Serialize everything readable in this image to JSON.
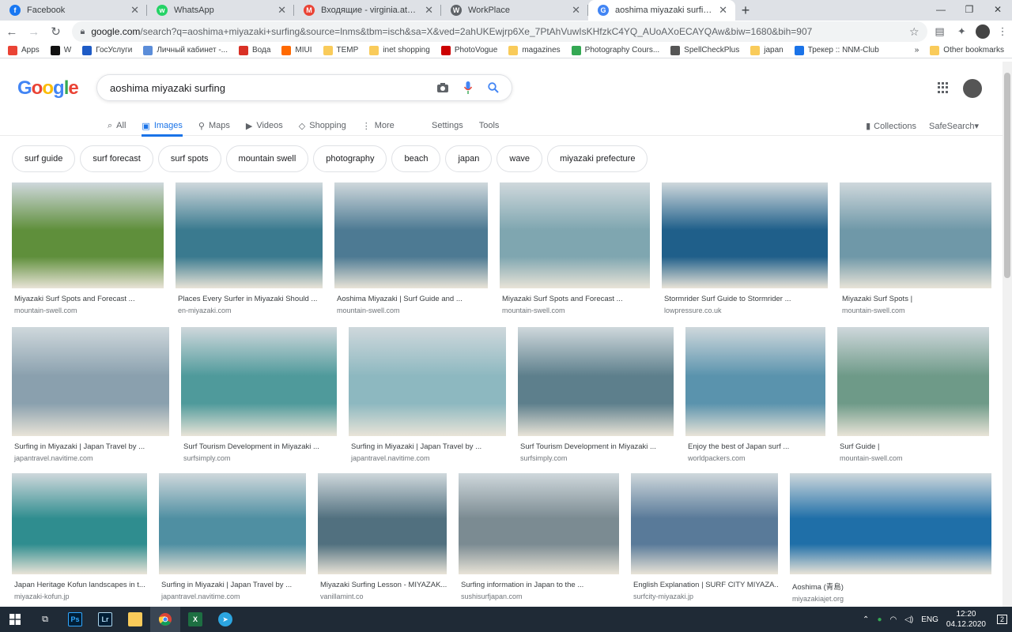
{
  "tabs": [
    {
      "title": "Facebook",
      "color": "#1877f2",
      "glyph": "f"
    },
    {
      "title": "WhatsApp",
      "color": "#25d366",
      "glyph": "w"
    },
    {
      "title": "Входящие - virginia.ateh@gmail.",
      "color": "#ea4335",
      "glyph": "M"
    },
    {
      "title": "WorkPlace",
      "color": "#5f6368",
      "glyph": "W"
    },
    {
      "title": "aoshima miyazaki surfing - Goog",
      "color": "#4285f4",
      "glyph": "G"
    }
  ],
  "address": {
    "host": "google.com",
    "path": "/search?q=aoshima+miyazaki+surfing&source=lnms&tbm=isch&sa=X&ved=2ahUKEwjrp6Xe_7PtAhVuwIsKHfzkC4YQ_AUoAXoECAYQAw&biw=1680&bih=907"
  },
  "bookmarks": [
    {
      "label": "Apps",
      "color": "#ea4335"
    },
    {
      "label": "W",
      "color": "#111111"
    },
    {
      "label": "ГосУслуги",
      "color": "#1e5bc6"
    },
    {
      "label": "Личный кабинет -...",
      "color": "#5b8dd9"
    },
    {
      "label": "Вода",
      "color": "#d93025"
    },
    {
      "label": "MIUI",
      "color": "#ff6900"
    },
    {
      "label": "TEMP",
      "color": "#f9cb5a"
    },
    {
      "label": "inet shopping",
      "color": "#f9cb5a"
    },
    {
      "label": "PhotoVogue",
      "color": "#cc0000"
    },
    {
      "label": "magazines",
      "color": "#f9cb5a"
    },
    {
      "label": "Photography Cours...",
      "color": "#34a853"
    },
    {
      "label": "SpellCheckPlus",
      "color": "#555555"
    },
    {
      "label": "japan",
      "color": "#f9cb5a"
    },
    {
      "label": "Трекер :: NNM-Club",
      "color": "#1a73e8"
    }
  ],
  "bookmarks_other": "Other bookmarks",
  "search": {
    "query": "aoshima miyazaki surfing"
  },
  "gtabs": [
    {
      "label": "All",
      "icon": "search-icon",
      "glyph": "⌕"
    },
    {
      "label": "Images",
      "icon": "image-icon",
      "glyph": "▣"
    },
    {
      "label": "Maps",
      "icon": "map-pin-icon",
      "glyph": "⚲"
    },
    {
      "label": "Videos",
      "icon": "video-icon",
      "glyph": "▶"
    },
    {
      "label": "Shopping",
      "icon": "tag-icon",
      "glyph": "◇"
    },
    {
      "label": "More",
      "icon": "more-icon",
      "glyph": "⋮"
    }
  ],
  "tools": [
    "Settings",
    "Tools"
  ],
  "right": {
    "collections": "Collections",
    "safesearch": "SafeSearch▾"
  },
  "chips": [
    "surf guide",
    "surf forecast",
    "surf spots",
    "mountain swell",
    "photography",
    "beach",
    "japan",
    "wave",
    "miyazaki prefecture"
  ],
  "results": [
    [
      {
        "title": "Miyazaki Surf Spots and Forecast ...",
        "source": "mountain-swell.com"
      },
      {
        "title": "Places Every Surfer in Miyazaki Should ...",
        "source": "en-miyazaki.com"
      },
      {
        "title": "Aoshima Miyazaki | Surf Guide and ...",
        "source": "mountain-swell.com"
      },
      {
        "title": "Miyazaki Surf Spots and Forecast ...",
        "source": "mountain-swell.com"
      },
      {
        "title": "Stormrider Surf Guide to Stormrider ...",
        "source": "lowpressure.co.uk"
      },
      {
        "title": "Miyazaki Surf Spots |",
        "source": "mountain-swell.com"
      }
    ],
    [
      {
        "title": "Surfing in Miyazaki | Japan Travel by ...",
        "source": "japantravel.navitime.com"
      },
      {
        "title": "Surf Tourism Development in Miyazaki ...",
        "source": "surfsimply.com"
      },
      {
        "title": "Surfing in Miyazaki | Japan Travel by ...",
        "source": "japantravel.navitime.com"
      },
      {
        "title": "Surf Tourism Development in Miyazaki ...",
        "source": "surfsimply.com"
      },
      {
        "title": "Enjoy the best of Japan surf ...",
        "source": "worldpackers.com"
      },
      {
        "title": "Surf Guide |",
        "source": "mountain-swell.com"
      }
    ],
    [
      {
        "title": "Japan Heritage Kofun landscapes in t...",
        "source": "miyazaki-kofun.jp"
      },
      {
        "title": "Surfing in Miyazaki | Japan Travel by ...",
        "source": "japantravel.navitime.com"
      },
      {
        "title": "Miyazaki Surfing Lesson - MIYAZAK...",
        "source": "vanillamint.co"
      },
      {
        "title": "Surfing information in Japan to the ...",
        "source": "sushisurfjapan.com"
      },
      {
        "title": "English Explanation | SURF CITY MIYAZA...",
        "source": "surfcity-miyazaki.jp"
      },
      {
        "title": "Aoshima (青島)",
        "source": "miyazakiajet.org"
      }
    ]
  ],
  "taskbar": {
    "lang": "ENG",
    "time": "12:20",
    "date": "04.12.2020",
    "notif": "2"
  }
}
